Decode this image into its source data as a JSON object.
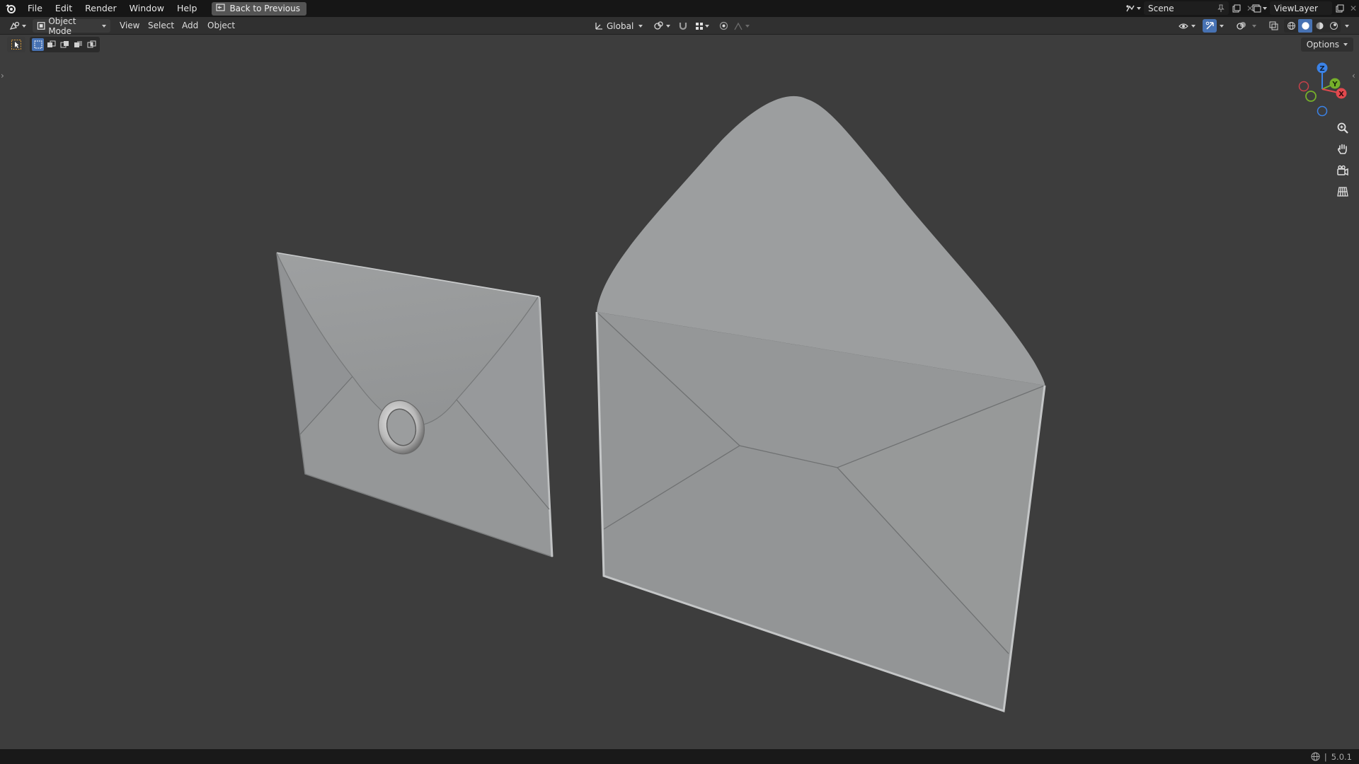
{
  "menu": {
    "items": [
      "File",
      "Edit",
      "Render",
      "Window",
      "Help"
    ],
    "back_label": "Back to Previous"
  },
  "scene": {
    "name": "Scene"
  },
  "view_layer": {
    "name": "ViewLayer"
  },
  "header": {
    "mode": "Object Mode",
    "items": [
      "View",
      "Select",
      "Add",
      "Object"
    ],
    "transform_orientation": "Global"
  },
  "viewport": {
    "options_label": "Options",
    "background": "#3d3d3d"
  },
  "gizmo": {
    "z": "Z",
    "y": "Y",
    "x": "X"
  },
  "statusbar": {
    "version": "5.0.1"
  },
  "colors": {
    "accent": "#4772b3",
    "axis_x": "#e2494e",
    "axis_y": "#76b02a",
    "axis_z": "#3b83e8"
  }
}
